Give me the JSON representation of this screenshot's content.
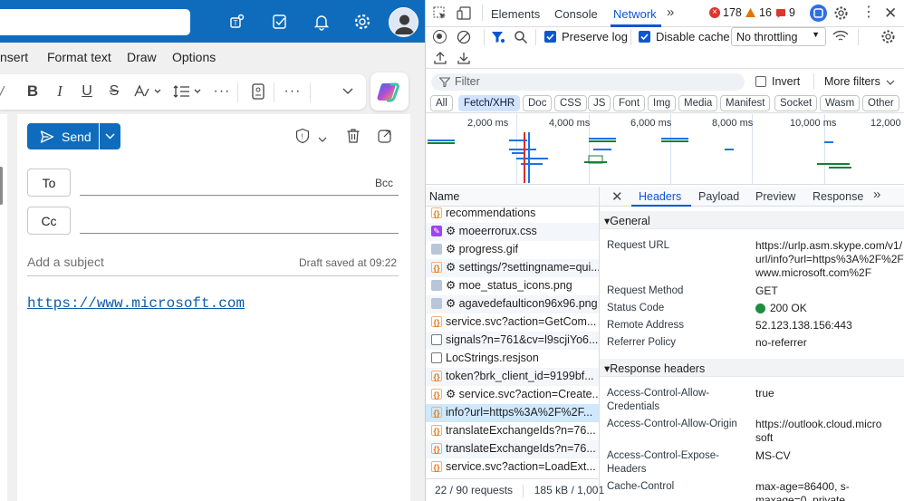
{
  "outlook": {
    "ribbon_tabs": [
      "nsert",
      "Format text",
      "Draw",
      "Options"
    ],
    "send_label": "Send",
    "to_label": "To",
    "cc_label": "Cc",
    "bcc_label": "Bcc",
    "subject_placeholder": "Add a subject",
    "draft_status": "Draft saved at 09:22",
    "body_link": "https://www.microsoft.com",
    "accent": "#0f6cbd"
  },
  "devtools": {
    "tabs": [
      "Elements",
      "Console",
      "Network"
    ],
    "active_tab": "Network",
    "errors": "178",
    "warnings": "16",
    "issues": "9",
    "preserve_log": "Preserve log",
    "disable_cache": "Disable cache",
    "throttling": "No throttling",
    "filter_placeholder": "Filter",
    "invert": "Invert",
    "more_filters": "More filters",
    "type_filters": [
      "All",
      "Fetch/XHR",
      "Doc",
      "CSS",
      "JS",
      "Font",
      "Img",
      "Media",
      "Manifest",
      "Socket",
      "Wasm",
      "Other"
    ],
    "selected_type": "Fetch/XHR",
    "timeline_labels": [
      "2,000 ms",
      "4,000 ms",
      "6,000 ms",
      "8,000 ms",
      "10,000 ms",
      "12,000"
    ],
    "name_header": "Name",
    "requests": [
      {
        "name": "recommendations",
        "type": "xhr"
      },
      {
        "name": "⚙ moeerrorux.css",
        "type": "css"
      },
      {
        "name": "⚙ progress.gif",
        "type": "img"
      },
      {
        "name": "⚙ settings/?settingname=qui...",
        "type": "xhr"
      },
      {
        "name": "⚙ moe_status_icons.png",
        "type": "img"
      },
      {
        "name": "⚙ agavedefaulticon96x96.png",
        "type": "img"
      },
      {
        "name": "service.svc?action=GetCom...",
        "type": "xhr"
      },
      {
        "name": "signals?n=761&cv=l9scjiYo6...",
        "type": "doc"
      },
      {
        "name": "LocStrings.resjson",
        "type": "doc"
      },
      {
        "name": "token?brk_client_id=9199bf...",
        "type": "xhr"
      },
      {
        "name": "⚙ service.svc?action=Create...",
        "type": "xhr"
      },
      {
        "name": "info?url=https%3A%2F%2F...",
        "type": "xhr"
      },
      {
        "name": "translateExchangeIds?n=76...",
        "type": "xhr"
      },
      {
        "name": "translateExchangeIds?n=76...",
        "type": "xhr"
      },
      {
        "name": "service.svc?action=LoadExt...",
        "type": "xhr"
      }
    ],
    "selected_request": "info?url=https%3A%2F%2F...",
    "status_requests": "22 / 90 requests",
    "status_size": "185 kB / 1,001",
    "detail_tabs": [
      "Headers",
      "Payload",
      "Preview",
      "Response"
    ],
    "general_title": "General",
    "general": [
      {
        "key": "Request URL",
        "value": "https://urlp.asm.skype.com/v1/url/info?url=https%3A%2F%2Fwww.microsoft.com%2F"
      },
      {
        "key": "Request Method",
        "value": "GET"
      },
      {
        "key": "Status Code",
        "value": "200 OK"
      },
      {
        "key": "Remote Address",
        "value": "52.123.138.156:443"
      },
      {
        "key": "Referrer Policy",
        "value": "no-referrer"
      }
    ],
    "response_title": "Response headers",
    "response_headers": [
      {
        "key": "Access-Control-Allow-Credentials",
        "value": "true"
      },
      {
        "key": "Access-Control-Allow-Origin",
        "value": "https://outlook.cloud.microsoft"
      },
      {
        "key": "Access-Control-Expose-Headers",
        "value": "MS-CV"
      },
      {
        "key": "Cache-Control",
        "value": "max-age=86400, s-maxage=0, private"
      }
    ]
  }
}
